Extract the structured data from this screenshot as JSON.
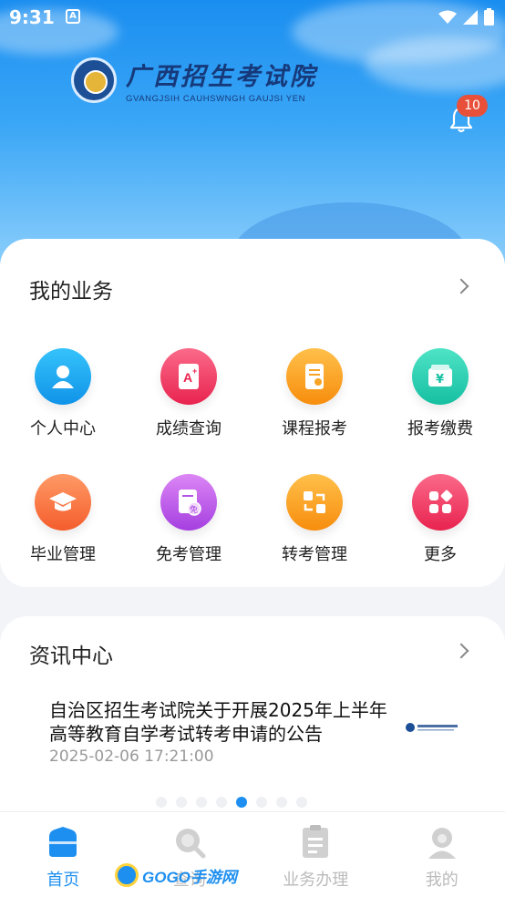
{
  "status_bar": {
    "time": "9:31",
    "keyboard_indicator": "A"
  },
  "header": {
    "logo_cn": "广西招生考试院",
    "logo_en": "GVANGJSIH CAUHSWNGH GAUJSI YEN",
    "notification_count": "10"
  },
  "business": {
    "title": "我的业务",
    "items": [
      {
        "label": "个人中心",
        "icon": "user-icon",
        "color": "#1ea7f2"
      },
      {
        "label": "成绩查询",
        "icon": "grade-icon",
        "color": "#f0446a"
      },
      {
        "label": "课程报考",
        "icon": "course-icon",
        "color": "#fba125"
      },
      {
        "label": "报考缴费",
        "icon": "payment-icon",
        "color": "#2fd0b6"
      },
      {
        "label": "毕业管理",
        "icon": "graduation-cap-icon",
        "color": "#fb7a48"
      },
      {
        "label": "免考管理",
        "icon": "exemption-icon",
        "color": "#c260e8"
      },
      {
        "label": "转考管理",
        "icon": "transfer-icon",
        "color": "#fba125"
      },
      {
        "label": "更多",
        "icon": "more-icon",
        "color": "#f0446a"
      }
    ]
  },
  "news": {
    "title": "资讯中心",
    "article_title": "自治区招生考试院关于开展2025年上半年高等教育自学考试转考申请的公告",
    "article_time": "2025-02-06 17:21:00",
    "carousel_total": 8,
    "carousel_active": 4
  },
  "tabbar": {
    "tabs": [
      {
        "label": "首页",
        "icon": "home-icon",
        "active": true
      },
      {
        "label": "查询",
        "icon": "search-icon",
        "active": false
      },
      {
        "label": "业务办理",
        "icon": "document-icon",
        "active": false
      },
      {
        "label": "我的",
        "icon": "profile-icon",
        "active": false
      }
    ]
  },
  "watermark": {
    "text": "GOGO手游网"
  },
  "colors": {
    "accent": "#1d8ff0",
    "badge": "#e8503a"
  }
}
